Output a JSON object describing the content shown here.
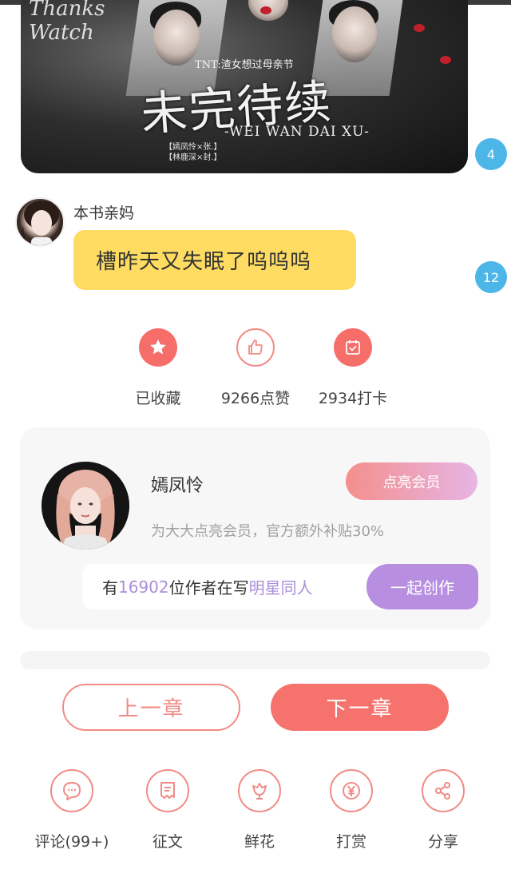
{
  "banner": {
    "signature": "Thanks\nWatch",
    "subtitle": "TNT:渣女想过母亲节",
    "title": "未完待续",
    "pinyin": "-WEI WAN DAI XU-",
    "names_line1": "【嫣凤怜×张.】",
    "names_line2": "【林鹿深×封.】",
    "badge": "4"
  },
  "comment": {
    "author": "本书亲妈",
    "text": "槽昨天又失眠了呜呜呜",
    "badge": "12"
  },
  "actions": {
    "collect": {
      "label": "已收藏",
      "icon": "star-icon"
    },
    "like": {
      "label": "9266点赞",
      "icon": "thumbs-up-icon"
    },
    "checkin": {
      "label": "2934打卡",
      "icon": "calendar-check-icon"
    }
  },
  "author_card": {
    "name": "嫣凤怜",
    "vip_button": "点亮会员",
    "description": "为大大点亮会员，官方额外补贴30%",
    "write_prefix": "有",
    "write_count": "16902",
    "write_middle": "位作者在写",
    "write_topic": "明星同人",
    "write_button": "一起创作"
  },
  "navigation": {
    "prev": "上一章",
    "next": "下一章"
  },
  "toolbar": {
    "comment": {
      "label": "评论(99+)",
      "icon": "comment-icon"
    },
    "contest": {
      "label": "征文",
      "icon": "document-icon"
    },
    "flower": {
      "label": "鲜花",
      "icon": "flower-icon"
    },
    "reward": {
      "label": "打赏",
      "icon": "yuan-coin-icon"
    },
    "share": {
      "label": "分享",
      "icon": "share-icon"
    }
  },
  "colors": {
    "accent": "#f6726d",
    "bubble": "#fedc62",
    "badge": "#4db6e8",
    "purple": "#b88ee0"
  }
}
